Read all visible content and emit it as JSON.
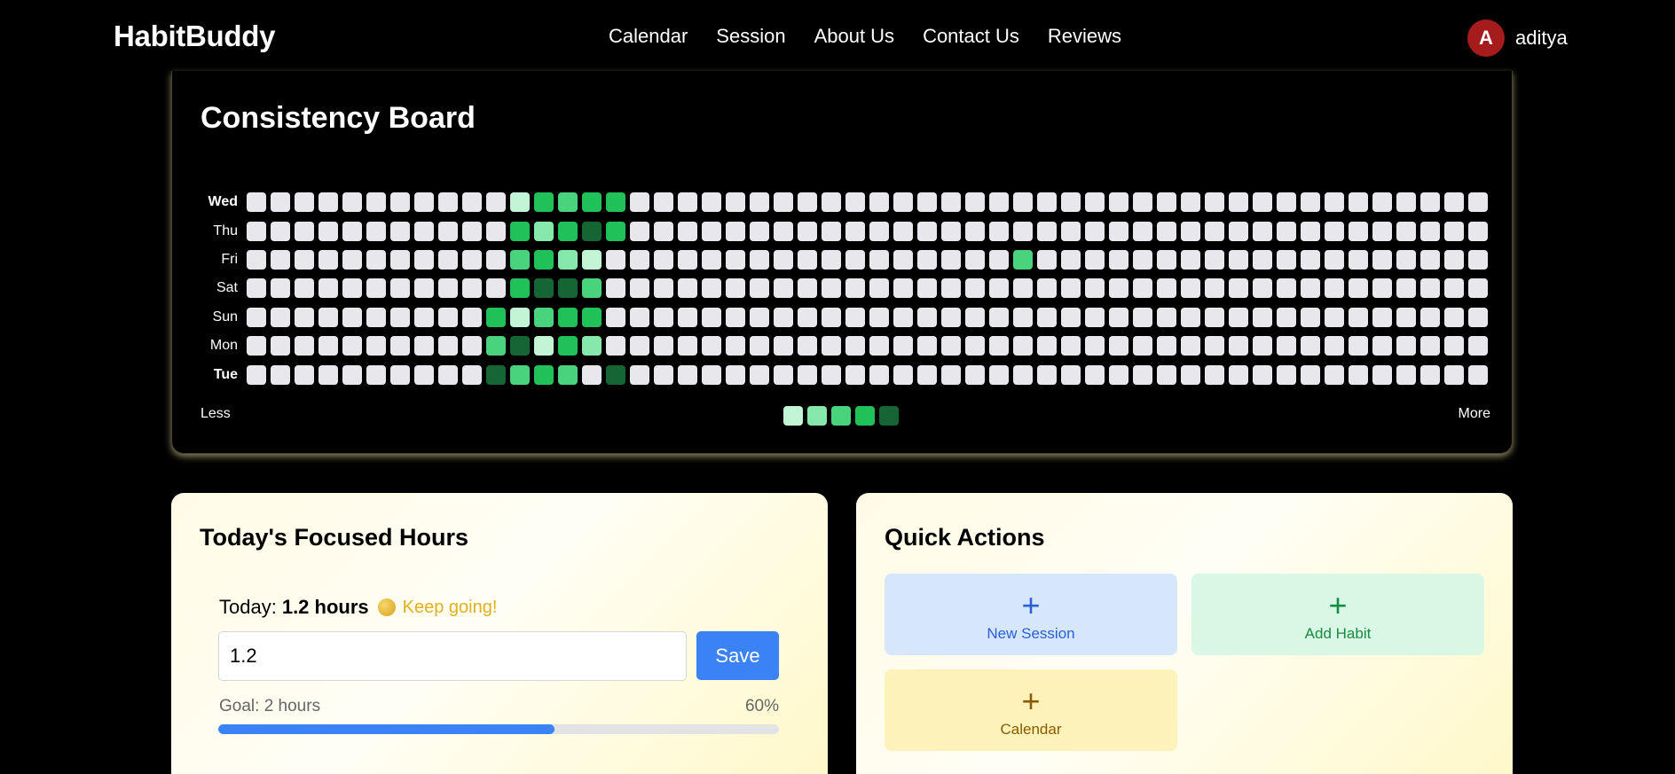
{
  "nav": {
    "logo": "HabitBuddy",
    "links": [
      "Calendar",
      "Session",
      "About Us",
      "Contact Us",
      "Reviews"
    ],
    "user": {
      "initial": "A",
      "name": "aditya"
    }
  },
  "board": {
    "title": "Consistency Board",
    "rows": [
      {
        "day": "Wed",
        "bold": true,
        "active": {
          "11": 1,
          "12": 4,
          "13": 3,
          "14": 4,
          "15": 4
        }
      },
      {
        "day": "Thu",
        "bold": false,
        "active": {
          "11": 4,
          "12": 2,
          "13": 4,
          "14": 5,
          "15": 4
        }
      },
      {
        "day": "Fri",
        "bold": false,
        "active": {
          "11": 3,
          "12": 4,
          "13": 2,
          "14": 1,
          "32": 3
        }
      },
      {
        "day": "Sat",
        "bold": false,
        "active": {
          "11": 4,
          "12": 5,
          "13": 5,
          "14": 3
        }
      },
      {
        "day": "Sun",
        "bold": false,
        "active": {
          "10": 4,
          "11": 1,
          "12": 3,
          "13": 4,
          "14": 4
        }
      },
      {
        "day": "Mon",
        "bold": false,
        "active": {
          "10": 3,
          "11": 5,
          "12": 1,
          "13": 4,
          "14": 2
        }
      },
      {
        "day": "Tue",
        "bold": true,
        "active": {
          "10": 5,
          "11": 3,
          "12": 4,
          "13": 3,
          "15": 5
        }
      }
    ],
    "weeks": 52,
    "less_label": "Less",
    "more_label": "More",
    "legend_levels": [
      1,
      2,
      3,
      4,
      5
    ],
    "level_colors": [
      "#e8e8ec",
      "#c2f5d6",
      "#86e8aa",
      "#4ad37d",
      "#21c159",
      "#166534"
    ]
  },
  "focus": {
    "title": "Today's Focused Hours",
    "today_prefix": "Today:",
    "today_hours": "1.2 hours",
    "encourage": "Keep going!",
    "input_value": "1.2",
    "save_label": "Save",
    "goal_label": "Goal: 2 hours",
    "percent_label": "60%",
    "progress": 0.6
  },
  "actions": {
    "title": "Quick Actions",
    "new_session": {
      "icon": "plus-icon",
      "label": "New Session"
    },
    "add_habit": {
      "icon": "plus-icon",
      "label": "Add Habit"
    },
    "calendar": {
      "icon": "plus-icon",
      "label": "Calendar"
    }
  }
}
